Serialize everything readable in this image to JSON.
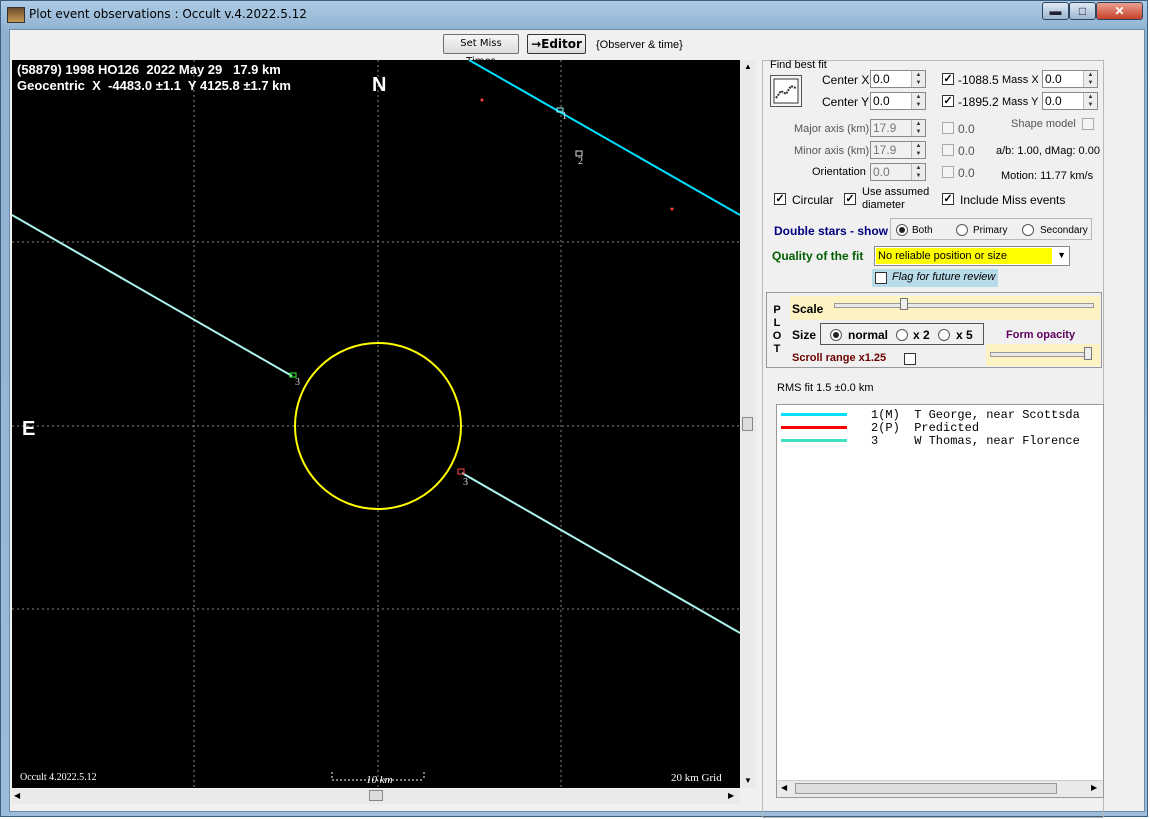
{
  "window": {
    "title": "Plot event observations : Occult v.4.2022.5.12",
    "min_label": "▬",
    "max_label": "□",
    "close_label": "✕"
  },
  "toolbar": {
    "set_miss_times_label": "Set Miss Times",
    "editor_label": "→Editor",
    "observer_time_label": "{Observer & time}"
  },
  "plot": {
    "header_line1": "(58879) 1998 HO126  2022 May 29   17.9 km",
    "header_line2": "Geocentric  X  -4483.0 ±1.1  Y 4125.8 ±1.7 km",
    "north_label": "N",
    "east_label": "E",
    "version_label": "Occult 4.2022.5.12",
    "scale_label": "10 km",
    "grid_label": "20 km Grid",
    "chord_labels": [
      "1",
      "2",
      "3",
      "3"
    ],
    "colors": {
      "background": "#000000",
      "ellipse": "#ffff00",
      "chord1": "#00e0ff",
      "chord3": "#7fffd4",
      "predicted": "#ff2020"
    }
  },
  "fit": {
    "find_best_fit_label": "Find best fit",
    "center_x_label": "Center X",
    "center_x_value": "0.0",
    "center_y_label": "Center Y",
    "center_y_value": "0.0",
    "fit_x_value": "-1088.5",
    "fit_y_value": "-1895.2",
    "mass_x_label": "Mass X",
    "mass_x_value": "0.0",
    "mass_y_label": "Mass Y",
    "mass_y_value": "0.0",
    "major_axis_label": "Major axis (km)",
    "major_axis_value": "17.9",
    "minor_axis_label": "Minor axis (km)",
    "minor_axis_value": "17.9",
    "orientation_label": "Orientation",
    "orientation_value": "0.0",
    "major_fit": "0.0",
    "minor_fit": "0.0",
    "orient_fit": "0.0",
    "shape_model_label": "Shape model",
    "ab_label": "a/b: 1.00, dMag: 0.00",
    "motion_label": "Motion: 11.77 km/s",
    "circular_label": "Circular",
    "use_assumed_label_1": "Use assumed",
    "use_assumed_label_2": "diameter",
    "include_miss_label": "Include Miss events"
  },
  "double_stars": {
    "label": "Double stars - show",
    "options": [
      "Both",
      "Primary",
      "Secondary"
    ],
    "selected": "Both"
  },
  "quality": {
    "label": "Quality of the fit",
    "value": "No reliable position or size",
    "flag_label": "Flag for future review"
  },
  "plot_controls": {
    "vertical_label": [
      "P",
      "L",
      "O",
      "T"
    ],
    "scale_label": "Scale",
    "size_label": "Size",
    "size_options": [
      "normal",
      "x 2",
      "x 5"
    ],
    "size_selected": "normal",
    "form_opacity_label": "Form opacity",
    "scroll_range_label": "Scroll range x1.25"
  },
  "rms_label": "RMS fit 1.5 ±0.0 km",
  "legend": [
    {
      "text": "1(M)  T George, near Scottsda",
      "color": "#00e0ff"
    },
    {
      "text": "2(P)  Predicted",
      "color": "#ff0000"
    },
    {
      "text": "3     W Thomas, near Florence",
      "color": "#40e0c0"
    }
  ]
}
